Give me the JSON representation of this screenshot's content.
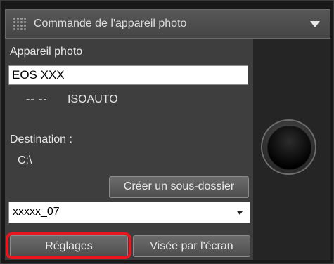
{
  "titlebar": {
    "title": "Commande de l'appareil photo",
    "grip_icon": "grip-icon",
    "menu_icon": "triangle-down-icon"
  },
  "camera": {
    "label": "Appareil photo",
    "model": "EOS XXX",
    "status_dashes": "-- --",
    "iso": "ISOAUTO"
  },
  "destination": {
    "label": "Destination :",
    "path": "C:\\"
  },
  "buttons": {
    "create_subfolder": "Créer un sous-dossier",
    "settings": "Réglages",
    "live_view": "Visée par l'écran"
  },
  "folder_select": {
    "value": "xxxxx_07",
    "arrow_icon": "chevron-down-icon"
  },
  "colors": {
    "highlight": "#e8161e",
    "panel": "#3e3e3e",
    "titlebar": "#4e4e4e"
  }
}
